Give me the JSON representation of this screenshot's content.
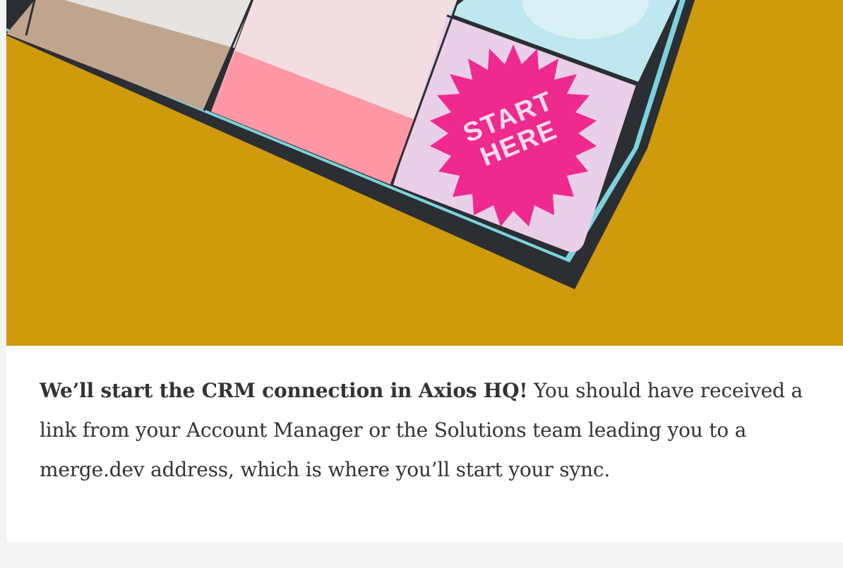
{
  "hero": {
    "badge_line1": "START",
    "badge_line2": "HERE",
    "colors": {
      "background": "#cf9a0c",
      "board_edge": "#2b2e33",
      "board_border": "#7cd3dc",
      "tile_tan": "#c0a58e",
      "tile_pink": "#ff97a5",
      "tile_blush": "#f2dde0",
      "tile_lilac": "#e9cfe8",
      "tile_sky": "#bfe7ef",
      "badge": "#ee2a8e"
    }
  },
  "body": {
    "lead_bold": "We’ll start the CRM connection in Axios HQ!",
    "lead_rest": " You should have received a link from your Account Manager or the Solutions team leading you to a merge.dev address, which is where you’ll start your sync."
  }
}
